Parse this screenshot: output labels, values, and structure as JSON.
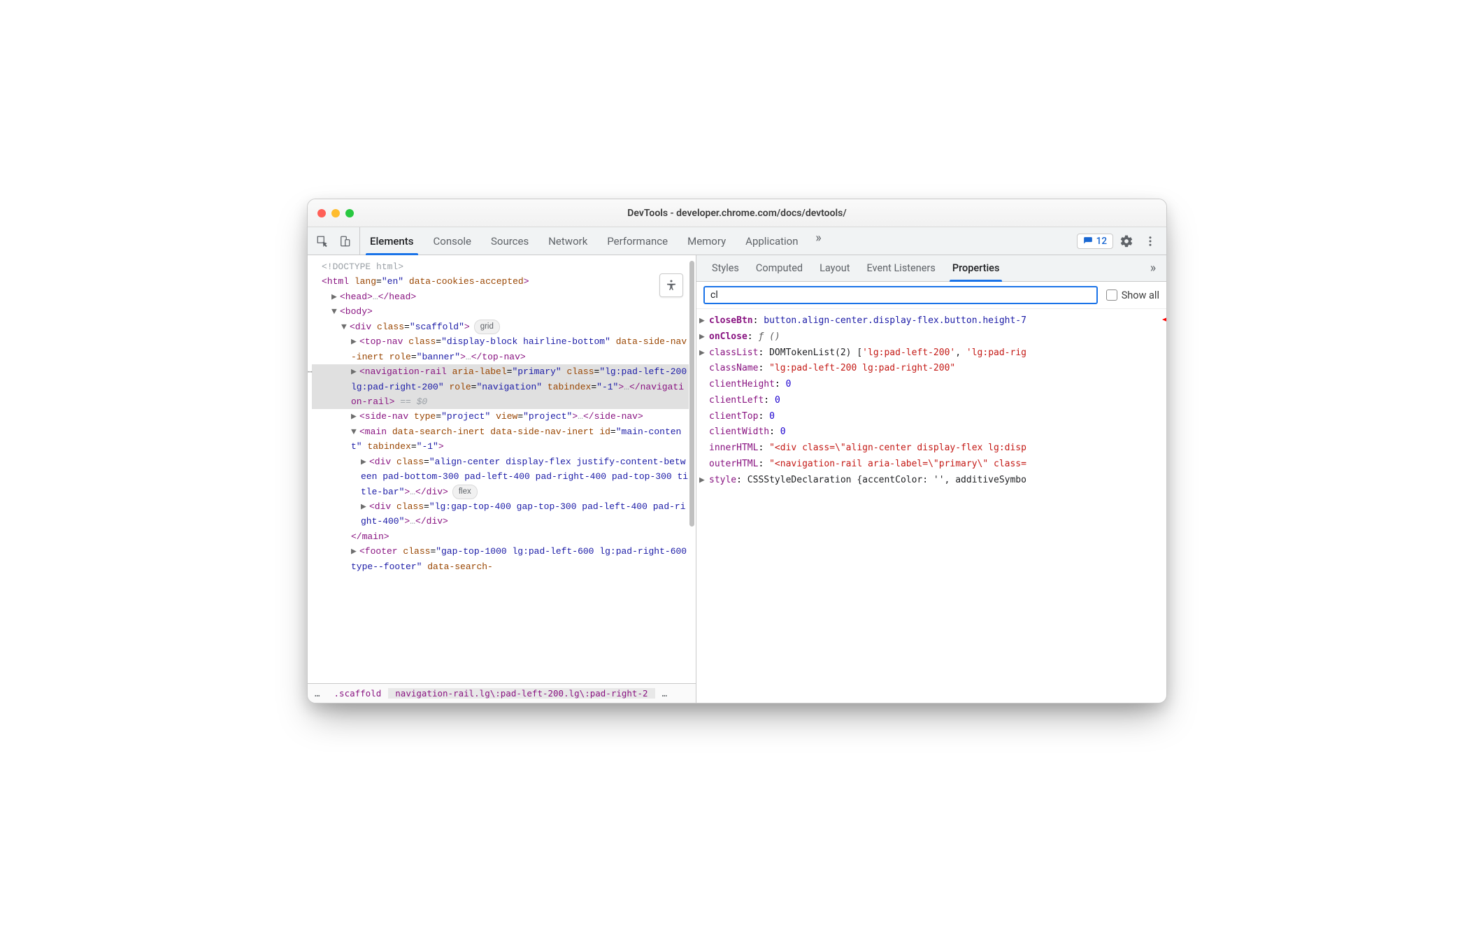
{
  "window": {
    "title": "DevTools - developer.chrome.com/docs/devtools/"
  },
  "toolbar": {
    "tabs": [
      "Elements",
      "Console",
      "Sources",
      "Network",
      "Performance",
      "Memory",
      "Application"
    ],
    "active_tab": "Elements",
    "issues_count": "12"
  },
  "dom": {
    "doctype": "<!DOCTYPE html>",
    "html_open": "<html lang=\"en\" data-cookies-accepted>",
    "head": "<head>…</head>",
    "body_open": "<body>",
    "scaffold_open": "<div class=\"scaffold\">",
    "scaffold_badge": "grid",
    "topnav": "<top-nav class=\"display-block hairline-bottom\" data-side-nav-inert role=\"banner\">…</top-nav>",
    "navrail": "<navigation-rail aria-label=\"primary\" class=\"lg:pad-left-200 lg:pad-right-200\" role=\"navigation\" tabindex=\"-1\">…</navigation-rail>",
    "navrail_eq": " == $0",
    "sidenav": "<side-nav type=\"project\" view=\"project\">…</side-nav>",
    "main_open": "<main data-search-inert data-side-nav-inert id=\"main-content\" tabindex=\"-1\">",
    "div1": "<div class=\"align-center display-flex justify-content-between pad-bottom-300 pad-left-400 pad-right-400 pad-top-300 title-bar\">…</div>",
    "div1_badge": "flex",
    "div2": "<div class=\"lg:gap-top-400 gap-top-300 pad-left-400 pad-right-400\">…</div>",
    "main_close": "</main>",
    "footer": "<footer class=\"gap-top-1000 lg:pad-left-600 lg:pad-right-600 type--footer\" data-search-"
  },
  "breadcrumb": {
    "c0": "…",
    "c1": ".scaffold",
    "c2": "navigation-rail.lg\\:pad-left-200.lg\\:pad-right-2",
    "c3": "…"
  },
  "sidepanel": {
    "tabs": [
      "Styles",
      "Computed",
      "Layout",
      "Event Listeners",
      "Properties"
    ],
    "active_tab": "Properties",
    "filter_value": "cl",
    "show_all_label": "Show all",
    "props": {
      "closeBtn": {
        "name": "closeBtn",
        "value": "button.align-center.display-flex.button.height-7"
      },
      "onClose": {
        "name": "onClose",
        "value": "ƒ ()"
      },
      "classList": {
        "name": "classList",
        "value": "DOMTokenList(2) ['lg:pad-left-200', 'lg:pad-rig"
      },
      "className": {
        "name": "className",
        "value": "\"lg:pad-left-200 lg:pad-right-200\""
      },
      "clientHeight": {
        "name": "clientHeight",
        "value": "0"
      },
      "clientLeft": {
        "name": "clientLeft",
        "value": "0"
      },
      "clientTop": {
        "name": "clientTop",
        "value": "0"
      },
      "clientWidth": {
        "name": "clientWidth",
        "value": "0"
      },
      "innerHTML": {
        "name": "innerHTML",
        "value": "\"<div class=\\\"align-center display-flex lg:disp"
      },
      "outerHTML": {
        "name": "outerHTML",
        "value": "\"<navigation-rail aria-label=\\\"primary\\\" class="
      },
      "style": {
        "name": "style",
        "value": "CSSStyleDeclaration {accentColor: '', additiveSymbo"
      }
    }
  }
}
